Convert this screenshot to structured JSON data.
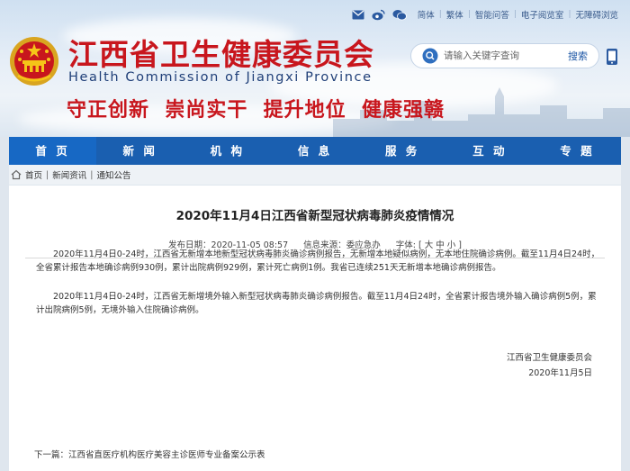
{
  "header": {
    "top_links": [
      "简体",
      "繁体",
      "智能问答",
      "电子阅览室",
      "无障碍浏览"
    ],
    "title_cn": "江西省卫生健康委员会",
    "title_en": "Health Commission of Jiangxi Province",
    "slogan": "守正创新  崇尚实干  提升地位  健康强赣",
    "search_placeholder": "请输入关键字查询",
    "search_button": "搜索"
  },
  "nav": {
    "items": [
      "首 页",
      "新 闻",
      "机 构",
      "信 息",
      "服 务",
      "互 动",
      "专 题"
    ]
  },
  "breadcrumb": {
    "items": [
      "首页",
      "新闻资讯",
      "通知公告"
    ]
  },
  "article": {
    "title": "2020年11月4日江西省新型冠状病毒肺炎疫情情况",
    "date_label": "发布日期：",
    "date": "2020-11-05 08:57",
    "source_label": "信息来源：",
    "source": "委应急办",
    "font_label": "字体:",
    "font_sizes": "[ 大 中 小 ]",
    "para1": "2020年11月4日0-24时，江西省无新增本地新型冠状病毒肺炎确诊病例报告，无新增本地疑似病例，无本地住院确诊病例。截至11月4日24时，全省累计报告本地确诊病例930例，累计出院病例929例，累计死亡病例1例。我省已连续251天无新增本地确诊病例报告。",
    "para2": "2020年11月4日0-24时，江西省无新增境外输入新型冠状病毒肺炎确诊病例报告。截至11月4日24时，全省累计报告境外输入确诊病例5例，累计出院病例5例，无境外输入住院确诊病例。",
    "signature": "江西省卫生健康委员会",
    "sign_date": "2020年11月5日",
    "next_label": "下一篇：",
    "next_title": "江西省直医疗机构医疗美容主诊医师专业备案公示表"
  },
  "colors": {
    "brand_red": "#c8161d",
    "nav_blue": "#1a5fb0",
    "link_blue": "#1d56a5"
  }
}
